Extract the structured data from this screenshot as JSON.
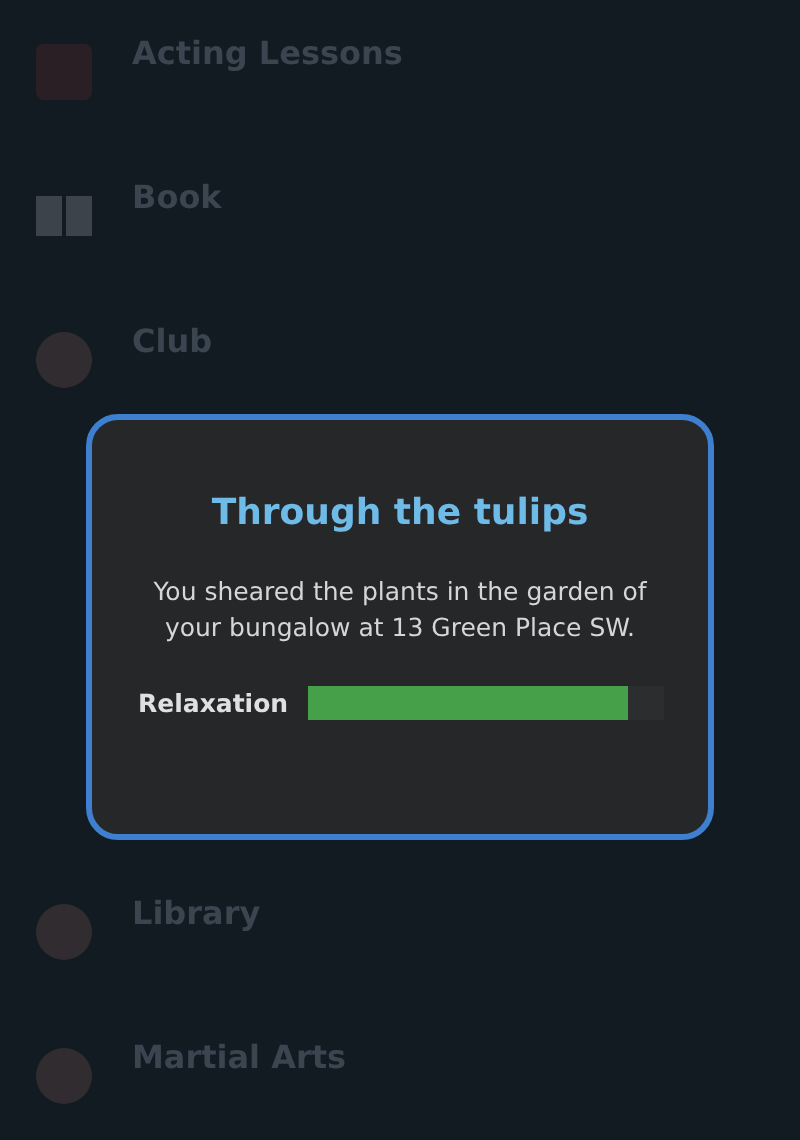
{
  "activities": [
    {
      "title": "Acting Lessons",
      "kind": "square"
    },
    {
      "title": "Book",
      "kind": "book"
    },
    {
      "title": "Club",
      "kind": "circle"
    },
    {
      "title": "Library",
      "kind": "circle"
    },
    {
      "title": "Martial Arts",
      "kind": "circle"
    }
  ],
  "dialog": {
    "title": "Through the tulips",
    "message": "You sheared the plants in the garden of your bungalow at 13 Green Place SW.",
    "meters": [
      {
        "label": "Relaxation",
        "level": 0.9
      }
    ]
  }
}
